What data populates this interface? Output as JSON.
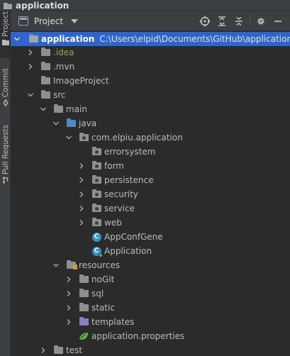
{
  "window": {
    "title": "application"
  },
  "side_tabs": [
    {
      "label": "Project"
    },
    {
      "label": "Commit"
    },
    {
      "label": "Pull Requests"
    }
  ],
  "panel": {
    "view_mode": "Project",
    "tools": [
      "locate-icon",
      "expand-all-icon",
      "collapse-all-icon",
      "settings-gear-icon",
      "minimize-icon"
    ]
  },
  "tree": {
    "root": {
      "label": "application",
      "path": "C:\\Users\\elpid\\Documents\\GitHub\\application"
    },
    "idea": ".idea",
    "mvn": ".mvn",
    "image_project": "ImageProject",
    "src": "src",
    "main": "main",
    "java": "java",
    "package": "com.elpiu.application",
    "errorsystem": "errorsystem",
    "form": "form",
    "persistence": "persistence",
    "security": "security",
    "service": "service",
    "web": "web",
    "app_conf": "AppConfGene",
    "app_class": "Application",
    "resources": "resources",
    "nogit": "noGit",
    "sql": "sql",
    "static": "static",
    "templates": "templates",
    "props": "application.properties",
    "test": "test"
  },
  "colors": {
    "selection": "#2f65ca",
    "ignored": "#a7a04a",
    "source_folder": "#4c8bc2"
  }
}
